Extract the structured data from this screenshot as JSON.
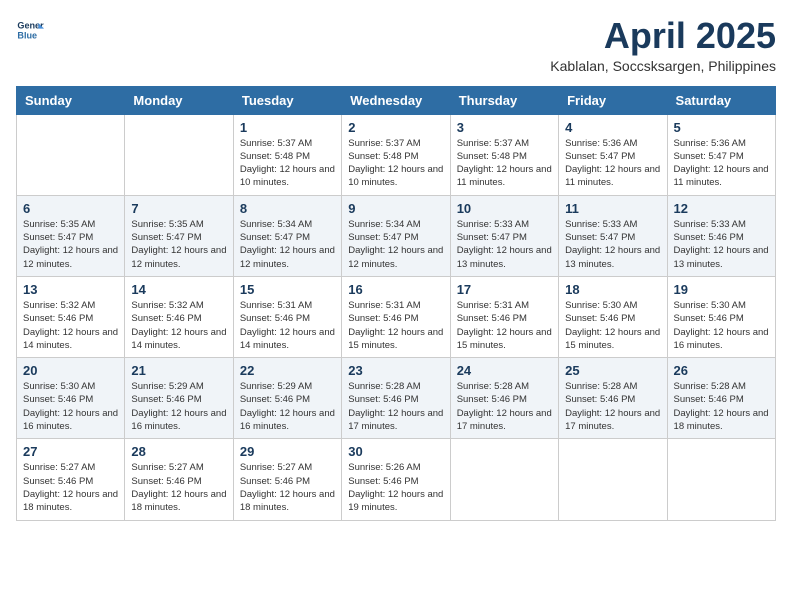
{
  "header": {
    "logo_line1": "General",
    "logo_line2": "Blue",
    "month": "April 2025",
    "location": "Kablalan, Soccsksargen, Philippines"
  },
  "weekdays": [
    "Sunday",
    "Monday",
    "Tuesday",
    "Wednesday",
    "Thursday",
    "Friday",
    "Saturday"
  ],
  "weeks": [
    [
      {
        "day": "",
        "info": ""
      },
      {
        "day": "",
        "info": ""
      },
      {
        "day": "1",
        "info": "Sunrise: 5:37 AM\nSunset: 5:48 PM\nDaylight: 12 hours and 10 minutes."
      },
      {
        "day": "2",
        "info": "Sunrise: 5:37 AM\nSunset: 5:48 PM\nDaylight: 12 hours and 10 minutes."
      },
      {
        "day": "3",
        "info": "Sunrise: 5:37 AM\nSunset: 5:48 PM\nDaylight: 12 hours and 11 minutes."
      },
      {
        "day": "4",
        "info": "Sunrise: 5:36 AM\nSunset: 5:47 PM\nDaylight: 12 hours and 11 minutes."
      },
      {
        "day": "5",
        "info": "Sunrise: 5:36 AM\nSunset: 5:47 PM\nDaylight: 12 hours and 11 minutes."
      }
    ],
    [
      {
        "day": "6",
        "info": "Sunrise: 5:35 AM\nSunset: 5:47 PM\nDaylight: 12 hours and 12 minutes."
      },
      {
        "day": "7",
        "info": "Sunrise: 5:35 AM\nSunset: 5:47 PM\nDaylight: 12 hours and 12 minutes."
      },
      {
        "day": "8",
        "info": "Sunrise: 5:34 AM\nSunset: 5:47 PM\nDaylight: 12 hours and 12 minutes."
      },
      {
        "day": "9",
        "info": "Sunrise: 5:34 AM\nSunset: 5:47 PM\nDaylight: 12 hours and 12 minutes."
      },
      {
        "day": "10",
        "info": "Sunrise: 5:33 AM\nSunset: 5:47 PM\nDaylight: 12 hours and 13 minutes."
      },
      {
        "day": "11",
        "info": "Sunrise: 5:33 AM\nSunset: 5:47 PM\nDaylight: 12 hours and 13 minutes."
      },
      {
        "day": "12",
        "info": "Sunrise: 5:33 AM\nSunset: 5:46 PM\nDaylight: 12 hours and 13 minutes."
      }
    ],
    [
      {
        "day": "13",
        "info": "Sunrise: 5:32 AM\nSunset: 5:46 PM\nDaylight: 12 hours and 14 minutes."
      },
      {
        "day": "14",
        "info": "Sunrise: 5:32 AM\nSunset: 5:46 PM\nDaylight: 12 hours and 14 minutes."
      },
      {
        "day": "15",
        "info": "Sunrise: 5:31 AM\nSunset: 5:46 PM\nDaylight: 12 hours and 14 minutes."
      },
      {
        "day": "16",
        "info": "Sunrise: 5:31 AM\nSunset: 5:46 PM\nDaylight: 12 hours and 15 minutes."
      },
      {
        "day": "17",
        "info": "Sunrise: 5:31 AM\nSunset: 5:46 PM\nDaylight: 12 hours and 15 minutes."
      },
      {
        "day": "18",
        "info": "Sunrise: 5:30 AM\nSunset: 5:46 PM\nDaylight: 12 hours and 15 minutes."
      },
      {
        "day": "19",
        "info": "Sunrise: 5:30 AM\nSunset: 5:46 PM\nDaylight: 12 hours and 16 minutes."
      }
    ],
    [
      {
        "day": "20",
        "info": "Sunrise: 5:30 AM\nSunset: 5:46 PM\nDaylight: 12 hours and 16 minutes."
      },
      {
        "day": "21",
        "info": "Sunrise: 5:29 AM\nSunset: 5:46 PM\nDaylight: 12 hours and 16 minutes."
      },
      {
        "day": "22",
        "info": "Sunrise: 5:29 AM\nSunset: 5:46 PM\nDaylight: 12 hours and 16 minutes."
      },
      {
        "day": "23",
        "info": "Sunrise: 5:28 AM\nSunset: 5:46 PM\nDaylight: 12 hours and 17 minutes."
      },
      {
        "day": "24",
        "info": "Sunrise: 5:28 AM\nSunset: 5:46 PM\nDaylight: 12 hours and 17 minutes."
      },
      {
        "day": "25",
        "info": "Sunrise: 5:28 AM\nSunset: 5:46 PM\nDaylight: 12 hours and 17 minutes."
      },
      {
        "day": "26",
        "info": "Sunrise: 5:28 AM\nSunset: 5:46 PM\nDaylight: 12 hours and 18 minutes."
      }
    ],
    [
      {
        "day": "27",
        "info": "Sunrise: 5:27 AM\nSunset: 5:46 PM\nDaylight: 12 hours and 18 minutes."
      },
      {
        "day": "28",
        "info": "Sunrise: 5:27 AM\nSunset: 5:46 PM\nDaylight: 12 hours and 18 minutes."
      },
      {
        "day": "29",
        "info": "Sunrise: 5:27 AM\nSunset: 5:46 PM\nDaylight: 12 hours and 18 minutes."
      },
      {
        "day": "30",
        "info": "Sunrise: 5:26 AM\nSunset: 5:46 PM\nDaylight: 12 hours and 19 minutes."
      },
      {
        "day": "",
        "info": ""
      },
      {
        "day": "",
        "info": ""
      },
      {
        "day": "",
        "info": ""
      }
    ]
  ]
}
